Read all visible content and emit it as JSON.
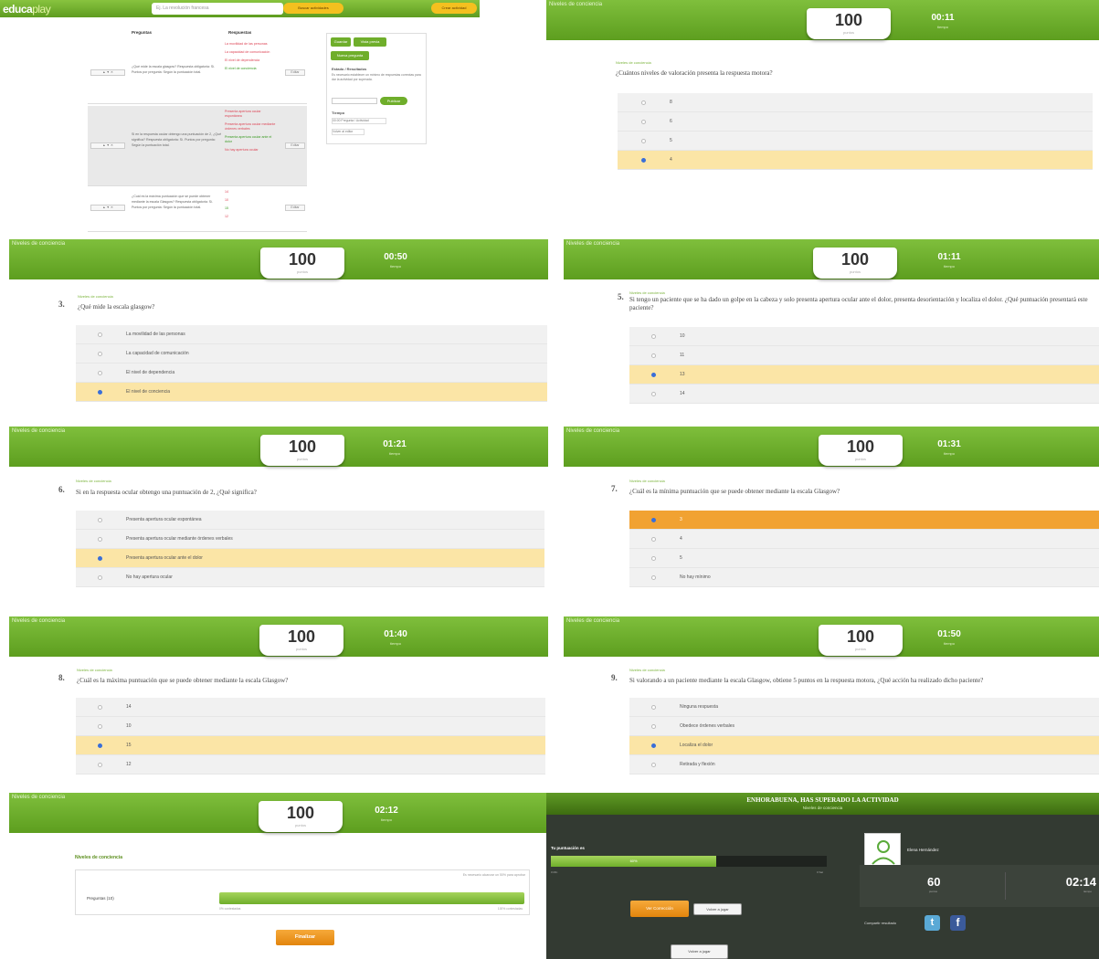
{
  "activity_title": "Niveles de conciencia",
  "score_caption": "puntos",
  "time_caption": "tiempo",
  "editor": {
    "logo_main": "educa",
    "logo_accent": "play",
    "search_placeholder": "Ej. La revolución francesa",
    "search_button": "Buscar actividades",
    "create_button": "Crear actividad",
    "col_questions": "Preguntas",
    "col_answers": "Respuestas",
    "row_controls": "▲ ▼ ✕",
    "edit_label": "Editar",
    "rows": [
      {
        "question": "¿Qué mide la escala glasgow? Respuesta obligatoria: Sí. Puntos por pregunta: Según la puntuación total.",
        "answers": [
          {
            "text": "La movilidad de las personas",
            "color": "r"
          },
          {
            "text": "La capacidad de comunicación",
            "color": "r"
          },
          {
            "text": "El nivel de dependencia",
            "color": "r"
          },
          {
            "text": "El nivel de conciencia",
            "color": "g"
          }
        ]
      },
      {
        "question": "Si en la respuesta ocular obtengo una puntuación de 2, ¿Qué significa? Respuesta obligatoria: Sí. Puntos por pregunta: Según la puntuación total.",
        "answers": [
          {
            "text": "Presenta apertura ocular espontánea",
            "color": "r"
          },
          {
            "text": "Presenta apertura ocular mediante órdenes verbales",
            "color": "r"
          },
          {
            "text": "Presenta apertura ocular ante el dolor",
            "color": "g"
          },
          {
            "text": "No hay apertura ocular",
            "color": "r"
          }
        ]
      },
      {
        "question": "¿Cuál es la máxima puntuación que se puede obtener mediante la escala Glasgow? Respuesta obligatoria: Sí. Puntos por pregunta: Según la puntuación total.",
        "answers": [
          {
            "text": "14",
            "color": "r"
          },
          {
            "text": "10",
            "color": "r"
          },
          {
            "text": "15",
            "color": "g"
          },
          {
            "text": "12",
            "color": "r"
          }
        ]
      }
    ],
    "side_buttons": [
      "Guardar",
      "Vista previa",
      "Nueva pregunta"
    ],
    "side_title_1": "Estado / Resultados",
    "side_text_1": "Es necesario establecer un mínimo de respuestas correctas para dar la actividad por superada.",
    "side_button_2": "Publicar",
    "side_title_2": "Tiempo",
    "side_text_2": "00:00  Pregunta / Actividad",
    "side_text_3": "Volver al editor"
  },
  "panels": [
    {
      "score": "100",
      "time": "00:11",
      "number": "",
      "question": "¿Cuántos niveles de valoración presenta la respuesta motora?",
      "answers": [
        "8",
        "6",
        "5",
        "4"
      ],
      "selected": 3,
      "highlight": -1
    },
    {
      "score": "100",
      "time": "00:50",
      "number": "3.",
      "question": "¿Qué mide la escala glasgow?",
      "answers": [
        "La movilidad de las personas",
        "La capacidad de comunicación",
        "El nivel de dependencia",
        "El nivel de conciencia"
      ],
      "selected": 3,
      "highlight": -1
    },
    {
      "score": "100",
      "time": "01:11",
      "number": "5.",
      "question": "Si tengo un paciente que se ha dado un golpe en la cabeza y solo presenta apertura ocular ante el dolor, presenta desorientación y localiza el dolor. ¿Qué puntuación presentará este paciente?",
      "answers": [
        "10",
        "11",
        "13",
        "14"
      ],
      "selected": 2,
      "highlight": -1
    },
    {
      "score": "100",
      "time": "01:21",
      "number": "6.",
      "question": "Si en la respuesta ocular obtengo una puntuación de 2, ¿Qué significa?",
      "answers": [
        "Presenta apertura ocular espontánea",
        "Presenta apertura ocular mediante órdenes verbales",
        "Presenta apertura ocular ante el dolor",
        "No hay apertura ocular"
      ],
      "selected": 2,
      "highlight": -1
    },
    {
      "score": "100",
      "time": "01:31",
      "number": "7.",
      "question": "¿Cuál es la mínima puntuación que se puede obtener mediante la escala Glasgow?",
      "answers": [
        "3",
        "4",
        "5",
        "No hay mínimo"
      ],
      "selected": 0,
      "highlight": 0
    },
    {
      "score": "100",
      "time": "01:40",
      "number": "8.",
      "question": "¿Cuál es la máxima puntuación que se puede obtener mediante la escala Glasgow?",
      "answers": [
        "14",
        "10",
        "15",
        "12"
      ],
      "selected": 2,
      "highlight": -1
    },
    {
      "score": "100",
      "time": "01:50",
      "number": "9.",
      "question": "Si valorando a un paciente mediante la escala Glasgow, obtiene 5 puntos en la respuesta motora, ¿Qué acción ha realizado dicho paciente?",
      "answers": [
        "Ninguna respuesta",
        "Obedece órdenes verbales",
        "Localiza el dolor",
        "Retirada y flexión"
      ],
      "selected": 2,
      "highlight": -1
    }
  ],
  "results": {
    "score": "100",
    "time": "02:12",
    "title": "Niveles de conciencia",
    "note": "Es necesario alcanzar un 50% para aprobar",
    "row_label": "Preguntas (10)",
    "bar_left": "0% contestadas",
    "bar_right": "100% contestadas",
    "progress": 1.0,
    "button": "Finalizar"
  },
  "congrats": {
    "title": "ENHORABUENA, HAS SUPERADO LA ACTIVIDAD",
    "subtitle": "Niveles de conciencia",
    "score_label": "Tu puntuación es",
    "score_bar_text": "60%",
    "score_progress": 0.6,
    "bar_min": "0 Min",
    "bar_max": "0 Sat",
    "user_name": "Elena Hernández",
    "points": "60",
    "points_caption": "puntos",
    "time": "02:14",
    "time_caption": "tiempo",
    "btn_corrections": "Ver Corrección",
    "btn_retry": "Volver a jugar",
    "share_label": "Compartir resultado",
    "btn_retry_bottom": "Volver a jugar"
  },
  "colors": {
    "header_green": "#6fae2b",
    "selected_answer": "#fbe5a6",
    "highlight_answer": "#f1a232",
    "dark_background": "#333a32"
  }
}
